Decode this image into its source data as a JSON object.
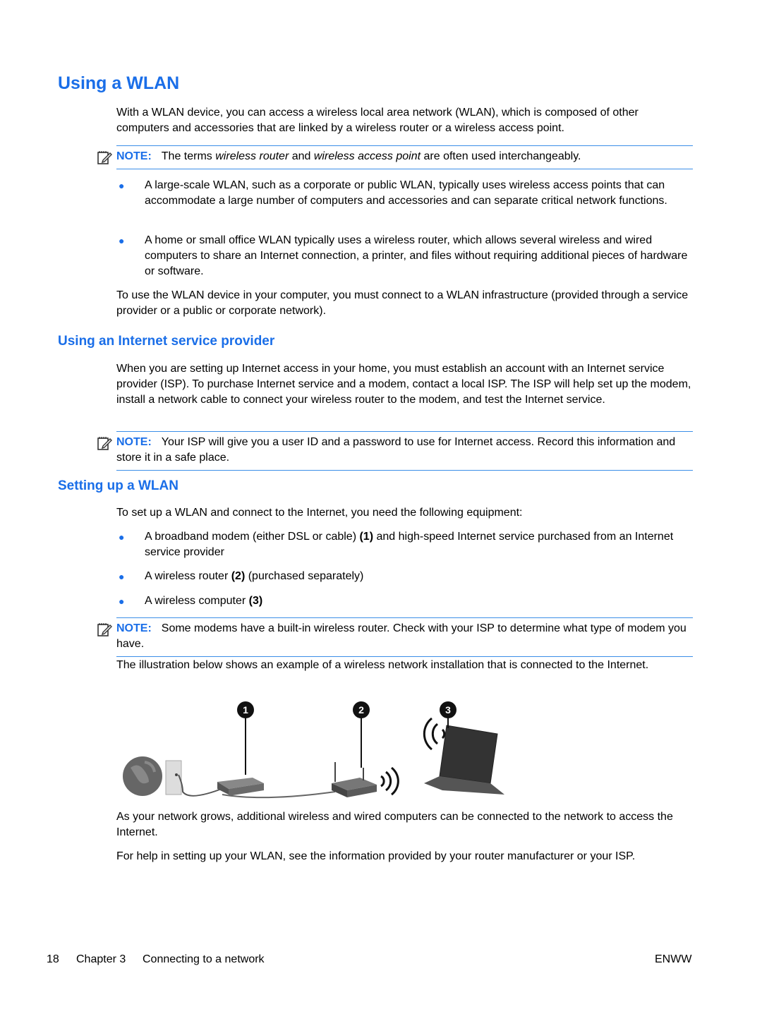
{
  "title": "Using a WLAN",
  "intro": "With a WLAN device, you can access a wireless local area network (WLAN), which is composed of other computers and accessories that are linked by a wireless router or a wireless access point.",
  "note1": {
    "label": "NOTE:",
    "pre": "The terms ",
    "em1": "wireless router",
    "mid": " and ",
    "em2": "wireless access point",
    "post": " are often used interchangeably."
  },
  "bullets1": [
    "A large-scale WLAN, such as a corporate or public WLAN, typically uses wireless access points that can accommodate a large number of computers and accessories and can separate critical network functions.",
    "A home or small office WLAN typically uses a wireless router, which allows several wireless and wired computers to share an Internet connection, a printer, and files without requiring additional pieces of hardware or software."
  ],
  "para2": "To use the WLAN device in your computer, you must connect to a WLAN infrastructure (provided through a service provider or a public or corporate network).",
  "section_isp": {
    "heading": "Using an Internet service provider",
    "body": "When you are setting up Internet access in your home, you must establish an account with an Internet service provider (ISP). To purchase Internet service and a modem, contact a local ISP. The ISP will help set up the modem, install a network cable to connect your wireless router to the modem, and test the Internet service.",
    "note": {
      "label": "NOTE:",
      "text": "Your ISP will give you a user ID and a password to use for Internet access. Record this information and store it in a safe place."
    }
  },
  "section_setup": {
    "heading": "Setting up a WLAN",
    "intro": "To set up a WLAN and connect to the Internet, you need the following equipment:",
    "bullets": [
      {
        "pre": "A broadband modem (either DSL or cable) ",
        "num": "(1)",
        "post": " and high-speed Internet service purchased from an Internet service provider"
      },
      {
        "pre": "A wireless router ",
        "num": "(2)",
        "post": " (purchased separately)"
      },
      {
        "pre": "A wireless computer ",
        "num": "(3)",
        "post": ""
      }
    ],
    "note": {
      "label": "NOTE:",
      "text": "Some modems have a built-in wireless router. Check with your ISP to determine what type of modem you have."
    },
    "illustration_intro": "The illustration below shows an example of a wireless network installation that is connected to the Internet.",
    "callouts": [
      "1",
      "2",
      "3"
    ],
    "para_grow": "As your network grows, additional wireless and wired computers can be connected to the network to access the Internet.",
    "para_help": "For help in setting up your WLAN, see the information provided by your router manufacturer or your ISP."
  },
  "footer": {
    "page": "18",
    "chapter": "Chapter 3",
    "chapter_title": "Connecting to a network",
    "right": "ENWW"
  }
}
